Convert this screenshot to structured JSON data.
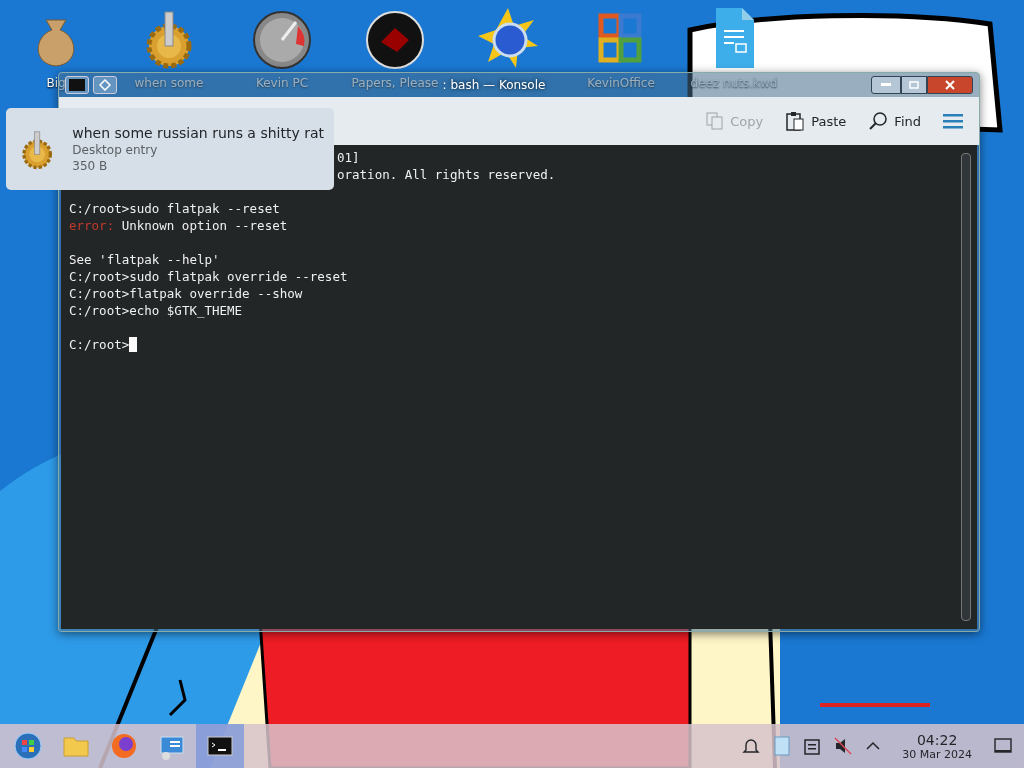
{
  "desktop_icons": [
    {
      "label": "Big",
      "kind": "money"
    },
    {
      "label": "when some",
      "kind": "gear"
    },
    {
      "label": "Kevin PC",
      "kind": "gauge"
    },
    {
      "label": "Papers, Please",
      "kind": "seal"
    },
    {
      "kind": "sun"
    },
    {
      "label": "KevinOffice",
      "kind": "office"
    },
    {
      "label": "deez nuts.kwd",
      "kind": "document"
    }
  ],
  "window": {
    "title": ": bash — Konsole",
    "toolbar": [
      {
        "label": "Copy",
        "kind": "copy",
        "disabled": true
      },
      {
        "label": "Paste",
        "kind": "paste",
        "disabled": false
      },
      {
        "label": "Find",
        "kind": "find",
        "disabled": false
      }
    ],
    "terminal": {
      "lines": [
        {
          "kind": "covered",
          "text": "01]"
        },
        {
          "kind": "covered",
          "text": "oration. All rights reserved."
        },
        {
          "kind": "blank"
        },
        {
          "kind": "text",
          "text": "C:/root>sudo flatpak --reset"
        },
        {
          "kind": "error",
          "label": "error:",
          "text": "Unknown option --reset"
        },
        {
          "kind": "blank"
        },
        {
          "kind": "text",
          "text": "See 'flatpak --help'"
        },
        {
          "kind": "text",
          "text": "C:/root>sudo flatpak override --reset"
        },
        {
          "kind": "text",
          "text": "C:/root>flatpak override --show"
        },
        {
          "kind": "text",
          "text": "C:/root>echo $GTK_THEME"
        },
        {
          "kind": "blank"
        },
        {
          "kind": "prompt",
          "text": "C:/root>"
        }
      ]
    }
  },
  "tooltip": {
    "title": "when some russian runs a shitty rat",
    "type": "Desktop entry",
    "size": "350 B"
  },
  "taskbar": {
    "apps": [
      {
        "kind": "start",
        "selected": false
      },
      {
        "kind": "folder",
        "selected": false
      },
      {
        "kind": "firefox",
        "selected": false
      },
      {
        "kind": "settings",
        "selected": false
      },
      {
        "kind": "terminal",
        "selected": true
      }
    ],
    "clock": {
      "time": "04:22",
      "date": "30 Mar 2024"
    }
  }
}
